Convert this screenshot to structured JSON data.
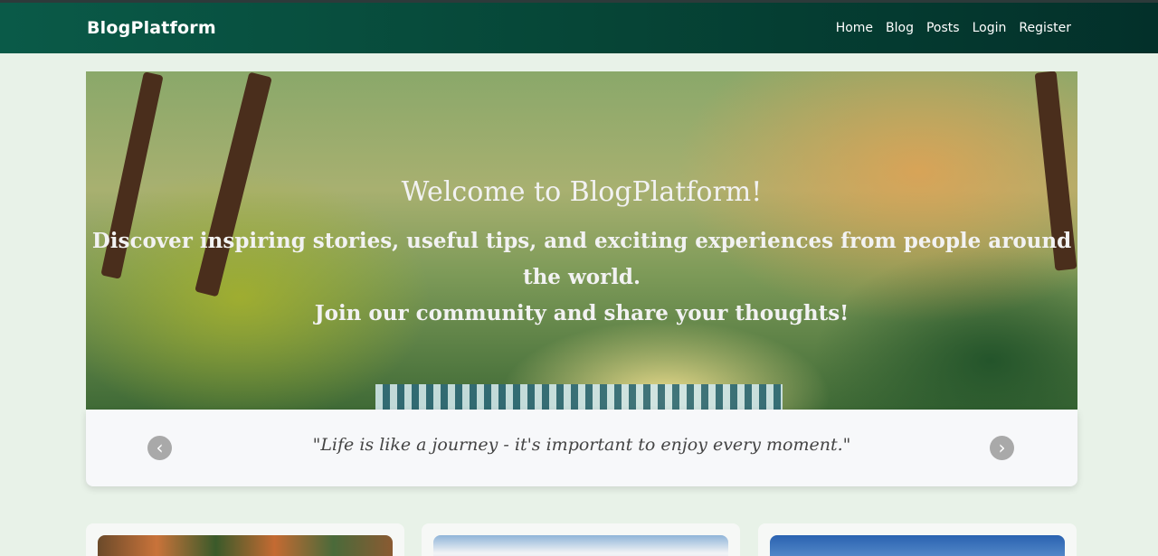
{
  "navbar": {
    "brand": "BlogPlatform",
    "links": [
      "Home",
      "Blog",
      "Posts",
      "Login",
      "Register"
    ]
  },
  "hero": {
    "title": "Welcome to BlogPlatform!",
    "subtitle_line1": "Discover inspiring stories, useful tips, and exciting experiences from people around the world.",
    "subtitle_line2": "Join our community and share your thoughts!"
  },
  "quote": {
    "text": "\"Life is like a journey - it's important to enjoy every moment.\"",
    "prev_icon": "chevron-left-icon",
    "next_icon": "chevron-right-icon"
  },
  "colors": {
    "navbar": "#064637",
    "background": "#e8f2e8",
    "quote_box": "#f7f8fa"
  }
}
